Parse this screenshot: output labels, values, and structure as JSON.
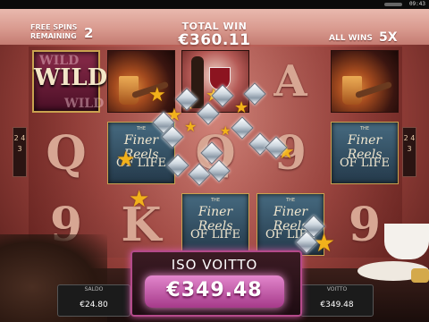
{
  "status_bar": {
    "clock": "09:43"
  },
  "header": {
    "free_spins_label": "FREE SPINS REMAINING",
    "free_spins_value": "2",
    "total_win_label": "TOTAL WIN",
    "total_win_value": "€360.11",
    "all_wins_label": "ALL WINS",
    "all_wins_value": "5X"
  },
  "reels": {
    "ways_left": "2 4 3",
    "ways_right": "2 4 3",
    "wild_label": "WILD",
    "card_q": "Q",
    "card_a": "A",
    "card_9": "9",
    "card_k": "K",
    "finer_reels_the": "THE",
    "finer_reels_title": "Finer Reels",
    "finer_reels_sub": "OF LIFE"
  },
  "big_win": {
    "label": "ISO VOITTO",
    "value": "€349.48",
    "accent_color": "#d65aa8"
  },
  "footer": {
    "credit_label": "SALDO",
    "credit_value": "€24.80",
    "win_label": "VOITTO",
    "win_value": "€349.48"
  },
  "colors": {
    "star": "#f2b21b",
    "header_bg": "#d99a8f",
    "reel_bg": "#a94b44"
  }
}
